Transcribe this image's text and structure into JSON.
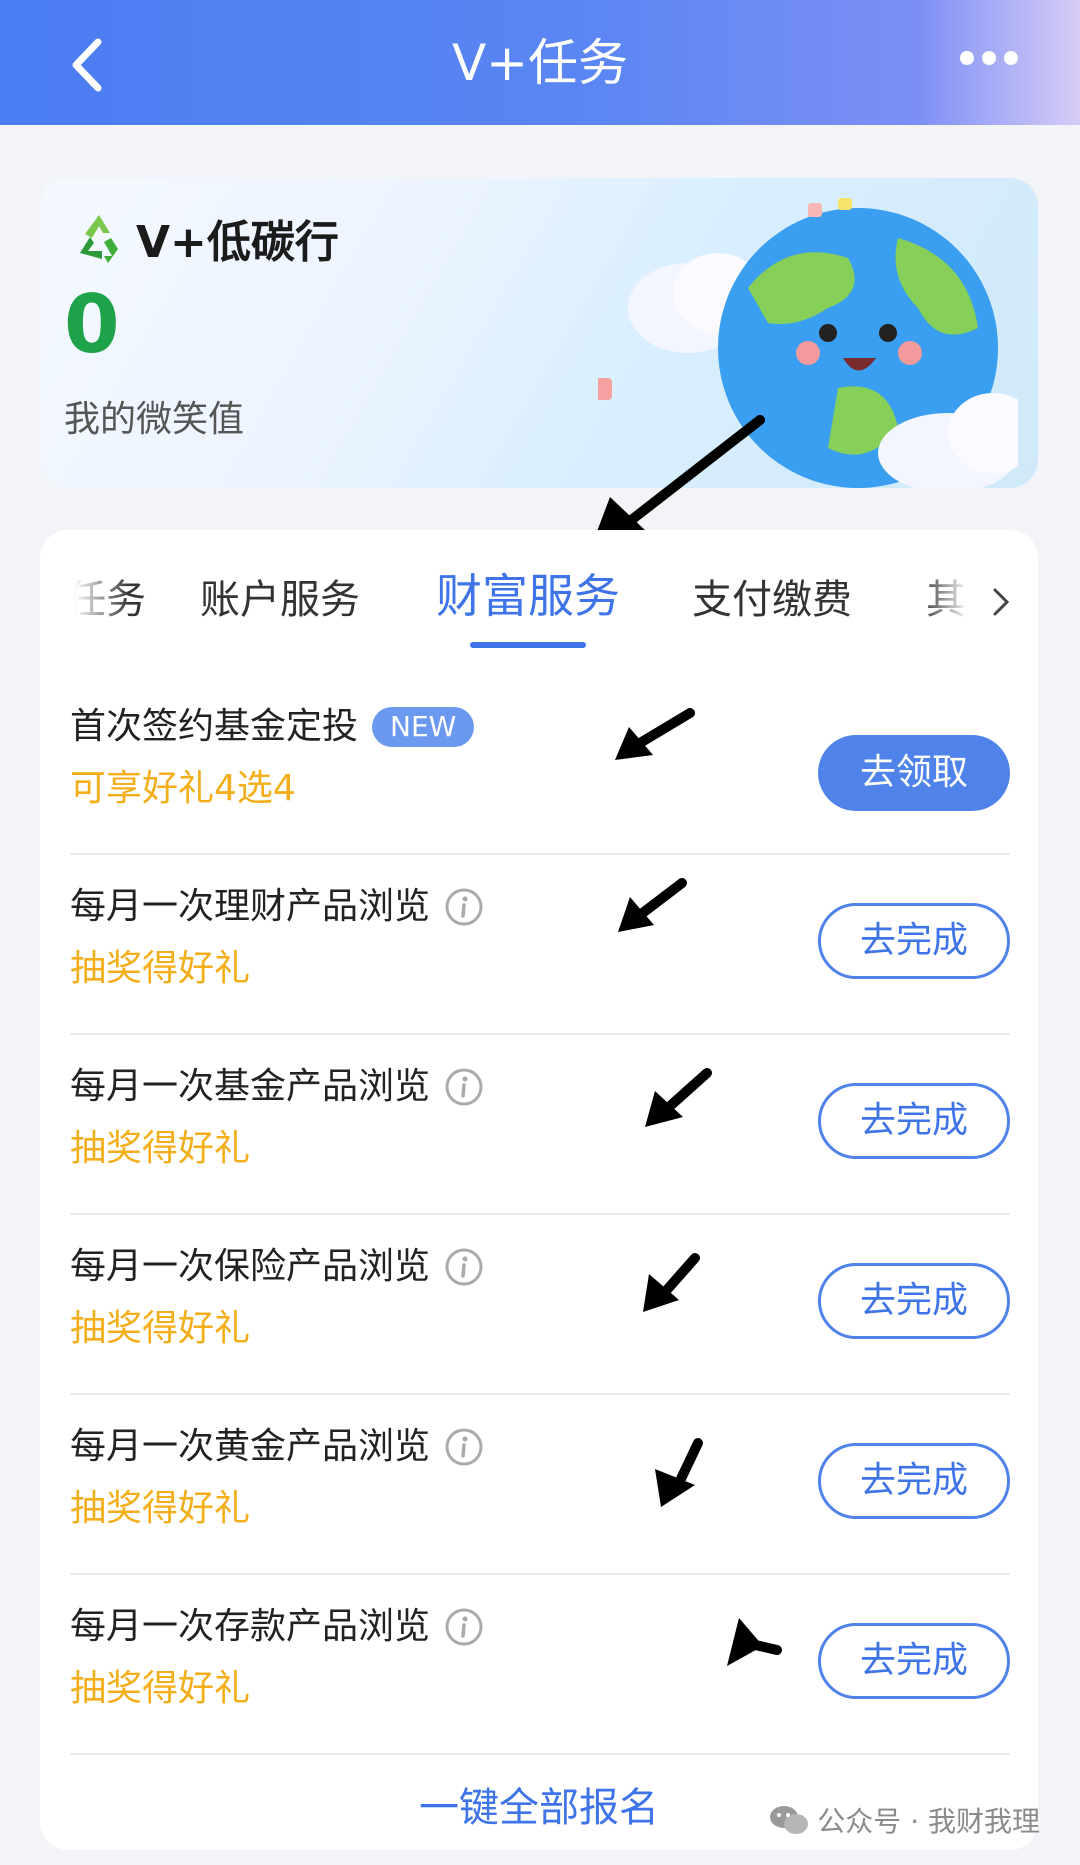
{
  "header": {
    "title": "V+任务"
  },
  "banner": {
    "title": "V+低碳行",
    "smile_value": "0",
    "smile_label": "我的微笑值"
  },
  "tabs": [
    {
      "label": "任务"
    },
    {
      "label": "账户服务"
    },
    {
      "label": "财富服务",
      "active": true
    },
    {
      "label": "支付缴费"
    },
    {
      "label": "其"
    }
  ],
  "tasks": [
    {
      "name": "首次签约基金定投",
      "badge": "NEW",
      "reward": "可享好礼4选4",
      "button": "去领取"
    },
    {
      "name": "每月一次理财产品浏览",
      "reward": "抽奖得好礼",
      "button": "去完成"
    },
    {
      "name": "每月一次基金产品浏览",
      "reward": "抽奖得好礼",
      "button": "去完成"
    },
    {
      "name": "每月一次保险产品浏览",
      "reward": "抽奖得好礼",
      "button": "去完成"
    },
    {
      "name": "每月一次黄金产品浏览",
      "reward": "抽奖得好礼",
      "button": "去完成"
    },
    {
      "name": "每月一次存款产品浏览",
      "reward": "抽奖得好礼",
      "button": "去完成"
    }
  ],
  "footer": {
    "signup_all": "一键全部报名"
  },
  "watermark": {
    "text": "公众号 · 我财我理"
  },
  "colors": {
    "primary": "#3e74e8",
    "reward": "#f4ae1a",
    "smile": "#1fa34a"
  }
}
